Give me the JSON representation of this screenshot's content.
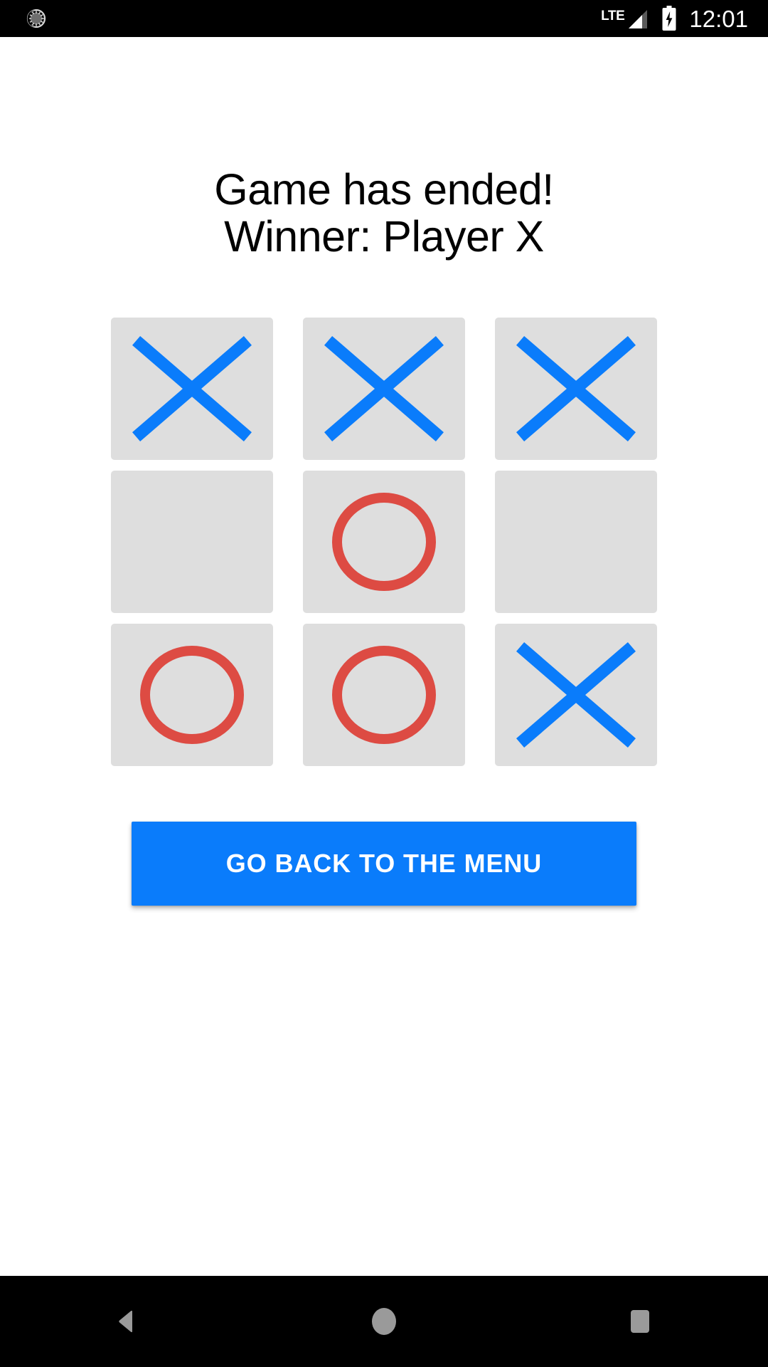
{
  "status_bar": {
    "sync_icon": "sync-icon",
    "network_label": "LTE",
    "signal_icon": "signal-bars-icon",
    "battery_icon": "battery-charging-icon",
    "time": "12:01",
    "background_color": "#000000",
    "foreground_color": "#ffffff"
  },
  "screen": {
    "title_line1": "Game has ended!",
    "title_line2": "Winner: Player X",
    "background_color": "#ffffff",
    "text_color": "#000000"
  },
  "board": {
    "rows": 3,
    "columns": 3,
    "cell_color": "#dedede",
    "x_color": "#0a7cfb",
    "o_color": "#dd4b43",
    "cells": [
      {
        "index": 0,
        "row": 0,
        "col": 0,
        "mark": "X",
        "label": "Player X"
      },
      {
        "index": 1,
        "row": 0,
        "col": 1,
        "mark": "X",
        "label": "Player X"
      },
      {
        "index": 2,
        "row": 0,
        "col": 2,
        "mark": "X",
        "label": "Player X"
      },
      {
        "index": 3,
        "row": 1,
        "col": 0,
        "mark": "",
        "label": "Empty"
      },
      {
        "index": 4,
        "row": 1,
        "col": 1,
        "mark": "O",
        "label": "Player O"
      },
      {
        "index": 5,
        "row": 1,
        "col": 2,
        "mark": "",
        "label": "Empty"
      },
      {
        "index": 6,
        "row": 2,
        "col": 0,
        "mark": "O",
        "label": "Player O"
      },
      {
        "index": 7,
        "row": 2,
        "col": 1,
        "mark": "O",
        "label": "Player O"
      },
      {
        "index": 8,
        "row": 2,
        "col": 2,
        "mark": "X",
        "label": "Player X"
      }
    ]
  },
  "actions": {
    "menu_button_label": "GO BACK TO THE MENU",
    "menu_button_color": "#0a7cfb",
    "menu_button_text_color": "#ffffff"
  },
  "nav_bar": {
    "background_color": "#000000",
    "icon_color": "#9a9a9a",
    "back_icon": "back-triangle-icon",
    "home_icon": "home-circle-icon",
    "recents_icon": "recents-square-icon"
  }
}
